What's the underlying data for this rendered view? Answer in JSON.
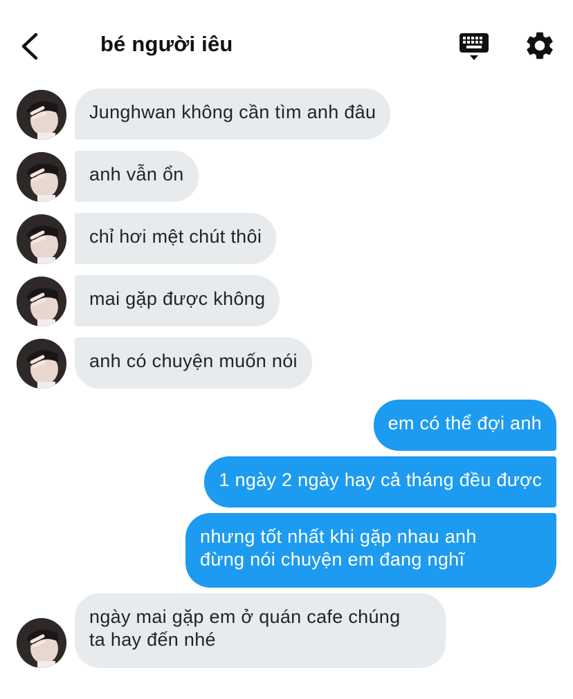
{
  "header": {
    "title": "bé người iêu",
    "back_icon": "chevron-left-icon",
    "keyboard_icon": "keyboard-icon",
    "settings_icon": "gear-icon"
  },
  "colors": {
    "incoming_bubble": "#e8ebee",
    "outgoing_bubble": "#1d9bf0",
    "background": "#ffffff"
  },
  "messages": [
    {
      "from": "them",
      "text": "Junghwan không cần tìm anh đâu"
    },
    {
      "from": "them",
      "text": "anh vẫn ổn"
    },
    {
      "from": "them",
      "text": "chỉ hơi mệt chút thôi"
    },
    {
      "from": "them",
      "text": "mai gặp được không"
    },
    {
      "from": "them",
      "text": "anh có chuyện muốn nói"
    },
    {
      "from": "me",
      "text": "em có thể đợi anh"
    },
    {
      "from": "me",
      "text": "1 ngày 2 ngày hay cả tháng đều được"
    },
    {
      "from": "me",
      "text": "nhưng tốt nhất khi gặp nhau anh\nđừng nói chuyện em đang nghĩ"
    },
    {
      "from": "them",
      "text": "ngày mai gặp em ở quán cafe chúng\nta hay đến nhé"
    }
  ]
}
